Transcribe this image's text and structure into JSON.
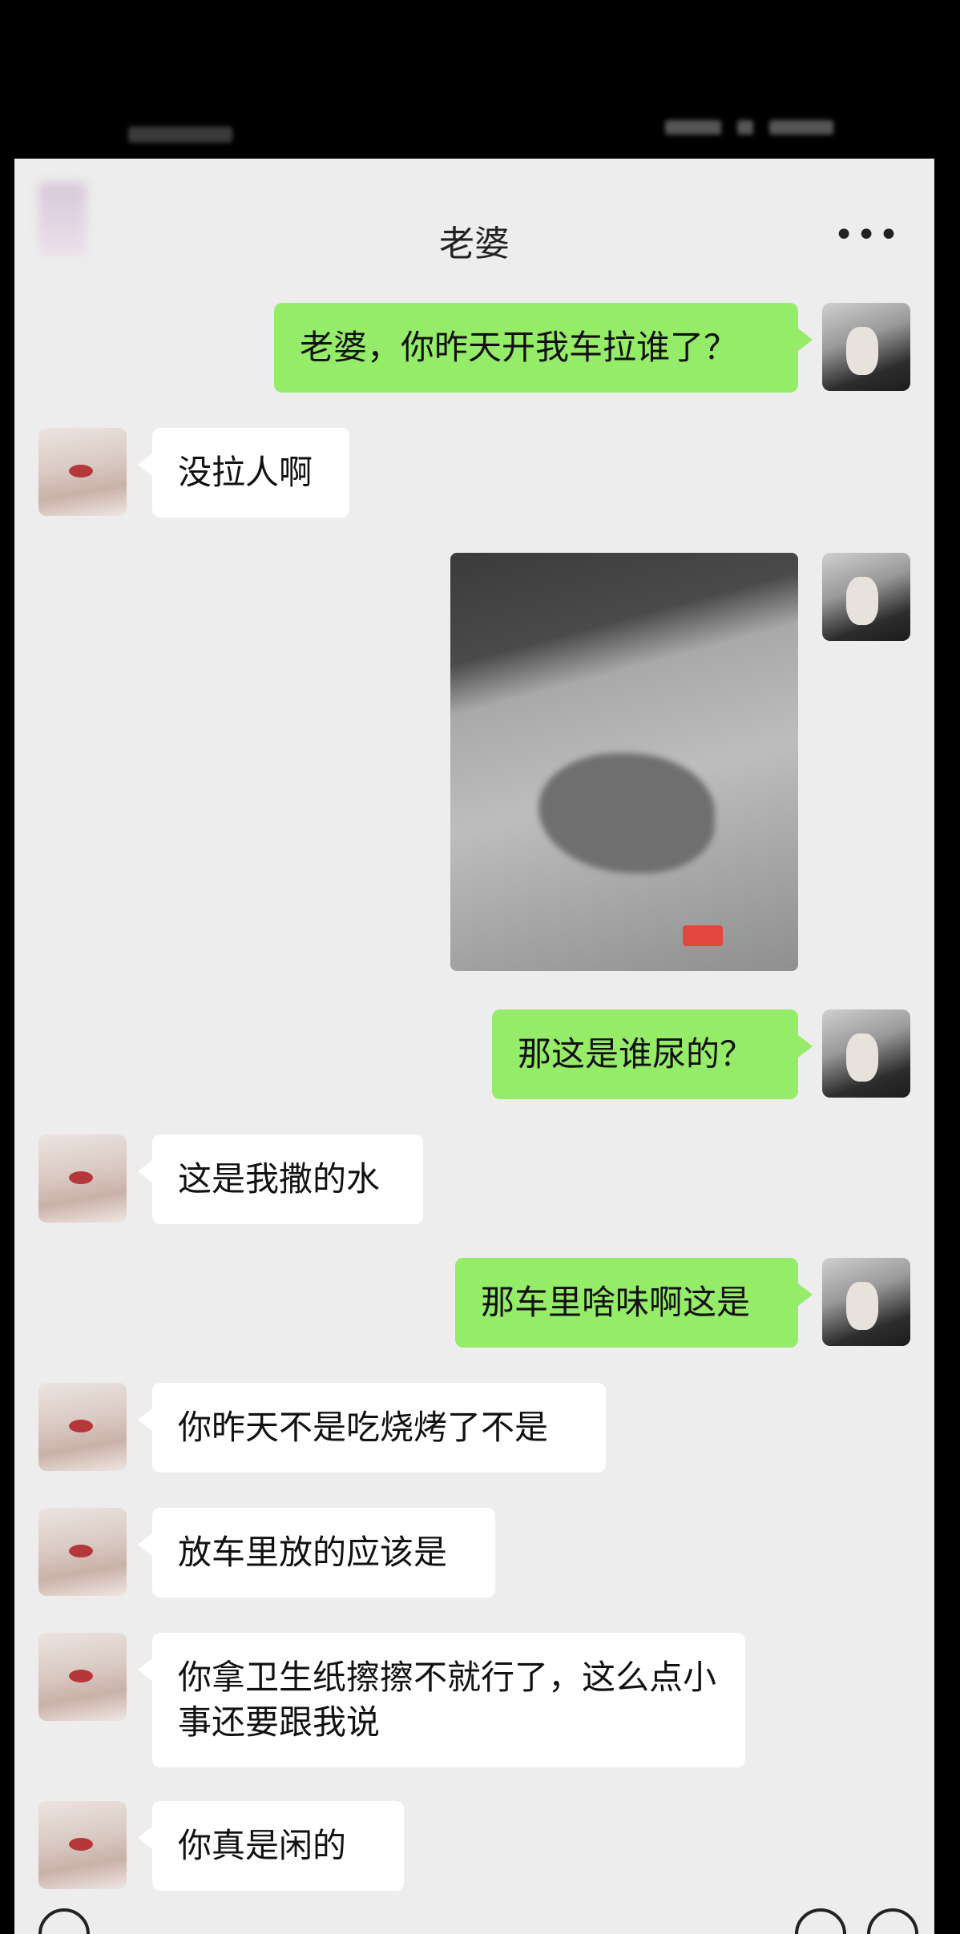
{
  "header": {
    "title": "老婆",
    "more_icon": "more-icon"
  },
  "messages": [
    {
      "side": "right",
      "type": "text",
      "text": "老婆，你昨天开我车拉谁了？"
    },
    {
      "side": "left",
      "type": "text",
      "text": "没拉人啊"
    },
    {
      "side": "right",
      "type": "image",
      "icon": "car-seat-photo"
    },
    {
      "side": "right",
      "type": "text",
      "text": "那这是谁尿的？"
    },
    {
      "side": "left",
      "type": "text",
      "text": "这是我撒的水"
    },
    {
      "side": "right",
      "type": "text",
      "text": "那车里啥味啊这是"
    },
    {
      "side": "left",
      "type": "text",
      "text": "你昨天不是吃烧烤了不是"
    },
    {
      "side": "left",
      "type": "text",
      "text": "放车里放的应该是"
    },
    {
      "side": "left",
      "type": "text",
      "text": "你拿卫生纸擦擦不就行了，这么点小事还要跟我说"
    },
    {
      "side": "left",
      "type": "text",
      "text": "你真是闲的"
    }
  ],
  "colors": {
    "sent_bubble": "#95ec69",
    "received_bubble": "#ffffff",
    "background": "#ededed"
  }
}
